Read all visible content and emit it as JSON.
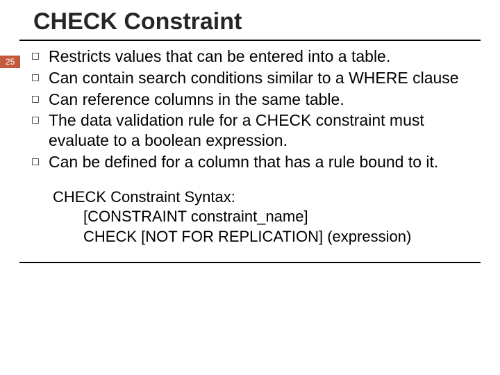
{
  "slide": {
    "title": "CHECK Constraint",
    "page_number": "25",
    "bullets": [
      "Restricts values that can be entered into a table.",
      "Can contain search conditions similar to a WHERE clause",
      "Can reference columns in the same table.",
      "The data validation rule for a CHECK constraint must evaluate to a boolean expression.",
      "Can be defined for a column that has a rule bound to it."
    ],
    "syntax": {
      "heading": "CHECK Constraint Syntax:",
      "line1": "[CONSTRAINT constraint_name]",
      "line2": "CHECK [NOT FOR REPLICATION] (expression)"
    }
  }
}
